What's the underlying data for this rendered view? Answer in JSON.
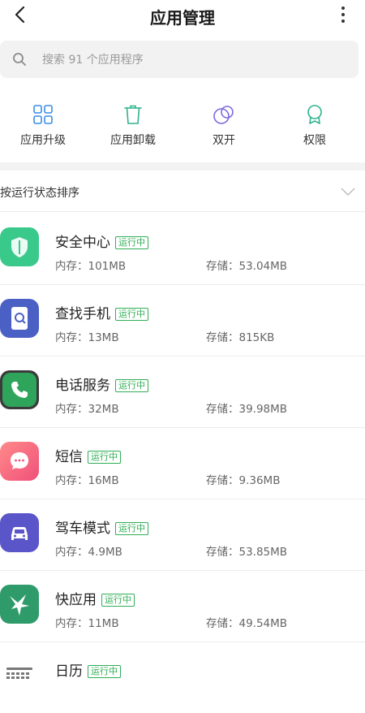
{
  "header": {
    "title": "应用管理"
  },
  "search": {
    "placeholder": "搜索 91 个应用程序"
  },
  "actions": [
    {
      "label": "应用升级"
    },
    {
      "label": "应用卸载"
    },
    {
      "label": "双开"
    },
    {
      "label": "权限"
    }
  ],
  "sort": {
    "label": "按运行状态排序"
  },
  "running_badge": "运行中",
  "apps": [
    {
      "name": "安全中心",
      "memory": "内存：101MB",
      "storage": "存储：53.04MB",
      "icon": "shield-icon",
      "color": "#39c98a"
    },
    {
      "name": "查找手机",
      "memory": "内存：13MB",
      "storage": "存储：815KB",
      "icon": "find-phone-icon",
      "color": "#4b60c4"
    },
    {
      "name": "电话服务",
      "memory": "内存：32MB",
      "storage": "存储：39.98MB",
      "icon": "phone-icon",
      "color": "#2fa55c"
    },
    {
      "name": "短信",
      "memory": "内存：16MB",
      "storage": "存储：9.36MB",
      "icon": "message-icon",
      "color": "#f4606f"
    },
    {
      "name": "驾车模式",
      "memory": "内存：4.9MB",
      "storage": "存储：53.85MB",
      "icon": "car-icon",
      "color": "#5a55c8"
    },
    {
      "name": "快应用",
      "memory": "内存：11MB",
      "storage": "存储：49.54MB",
      "icon": "bird-icon",
      "color": "#2f9b6b"
    },
    {
      "name": "日历",
      "memory": "",
      "storage": "",
      "icon": "calendar-icon",
      "color": "#ffffff"
    }
  ]
}
